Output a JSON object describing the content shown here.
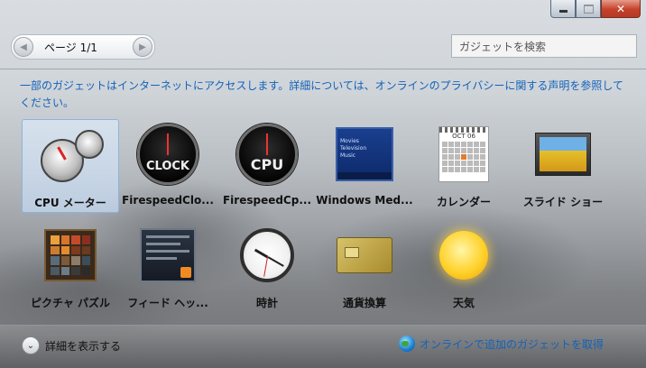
{
  "window": {
    "caption": {
      "minimize": "minimize",
      "maximize": "maximize",
      "close": "close"
    },
    "close_glyph": "✕"
  },
  "toolbar": {
    "page_label": "ページ 1/1",
    "prev_glyph": "◀",
    "next_glyph": "▶",
    "search_placeholder": "ガジェットを検索"
  },
  "notice": "一部のガジェットはインターネットにアクセスします。詳細については、オンラインのプライバシーに関する声明を参照してください。",
  "gadgets": [
    {
      "label": "CPU メーター",
      "icon": "cpu-meter-icon",
      "selected": true
    },
    {
      "label": "FirespeedClo...",
      "icon": "firespeed-clock-icon",
      "icon_text": "CLOCK"
    },
    {
      "label": "FirespeedCp...",
      "icon": "firespeed-cpu-icon",
      "icon_text": "CPU"
    },
    {
      "label": "Windows Med...",
      "icon": "windows-media-center-icon",
      "icon_lines": [
        "Movies",
        "Television",
        "Music"
      ]
    },
    {
      "label": "カレンダー",
      "icon": "calendar-icon",
      "icon_text": "OCT 06"
    },
    {
      "label": "スライド ショー",
      "icon": "slide-show-icon"
    },
    {
      "label": "ピクチャ パズル",
      "icon": "picture-puzzle-icon"
    },
    {
      "label": "フィード ヘッ...",
      "icon": "feed-headlines-icon"
    },
    {
      "label": "時計",
      "icon": "clock-icon"
    },
    {
      "label": "通貨換算",
      "icon": "currency-icon"
    },
    {
      "label": "天気",
      "icon": "weather-icon"
    }
  ],
  "footer": {
    "details_label": "詳細を表示する",
    "details_glyph": "⌄",
    "online_label": "オンラインで追加のガジェットを取得"
  },
  "colors": {
    "link": "#1462b8",
    "selected_bg": "#c4d8f0",
    "close_button": "#c6412a"
  }
}
